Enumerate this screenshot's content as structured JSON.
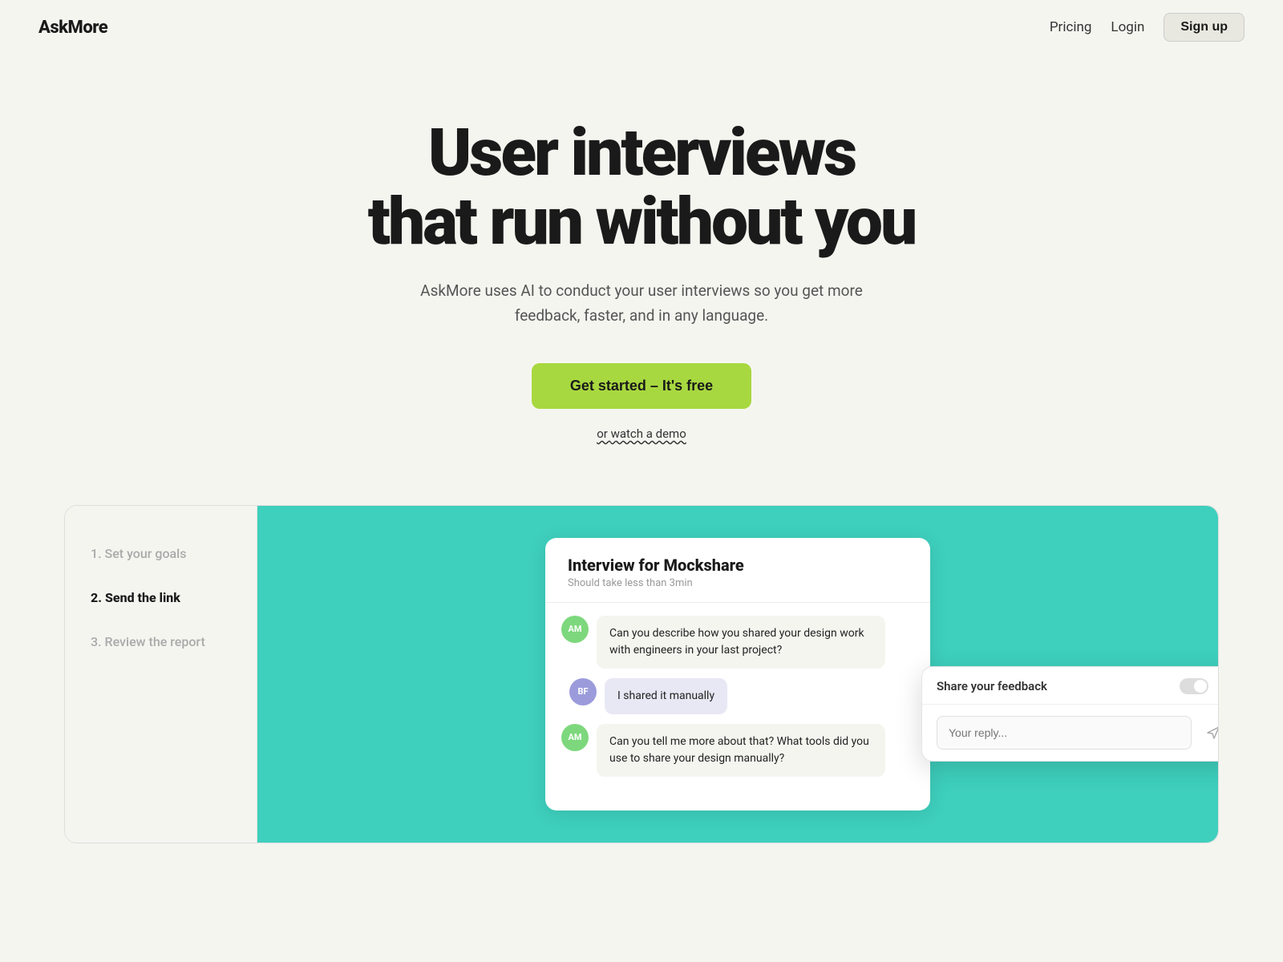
{
  "nav": {
    "logo": "AskMore",
    "links": [
      {
        "label": "Pricing",
        "id": "pricing"
      },
      {
        "label": "Login",
        "id": "login"
      }
    ],
    "signup_label": "Sign up"
  },
  "hero": {
    "title_line1": "User interviews",
    "title_line2": "that run without you",
    "subtitle": "AskMore uses AI to conduct your user interviews so you get more feedback, faster, and in any language.",
    "cta_label": "Get started – It's free",
    "watch_demo_prefix": "or ",
    "watch_demo_link": "watch a demo"
  },
  "demo": {
    "sidebar_steps": [
      {
        "label": "1. Set your goals",
        "active": false
      },
      {
        "label": "2. Send the link",
        "active": true
      },
      {
        "label": "3. Review the report",
        "active": false
      }
    ],
    "interview": {
      "title": "Interview for Mockshare",
      "subtitle": "Should take less than 3min",
      "messages": [
        {
          "avatar": "AM",
          "avatar_class": "avatar-am",
          "text": "Can you describe how you shared your design work with engineers in your last project?",
          "self": false
        },
        {
          "avatar": "BF",
          "avatar_class": "avatar-bf",
          "text": "I shared it manually",
          "self": true,
          "bubble_class": "purple-bg"
        },
        {
          "avatar": "AM",
          "avatar_class": "avatar-am",
          "text": "Can you tell me more about that? What tools did you use to share your design manually?",
          "self": false
        }
      ]
    },
    "feedback_popup": {
      "title": "Share your feedback",
      "input_placeholder": "Your reply...",
      "send_icon": "➤"
    }
  }
}
